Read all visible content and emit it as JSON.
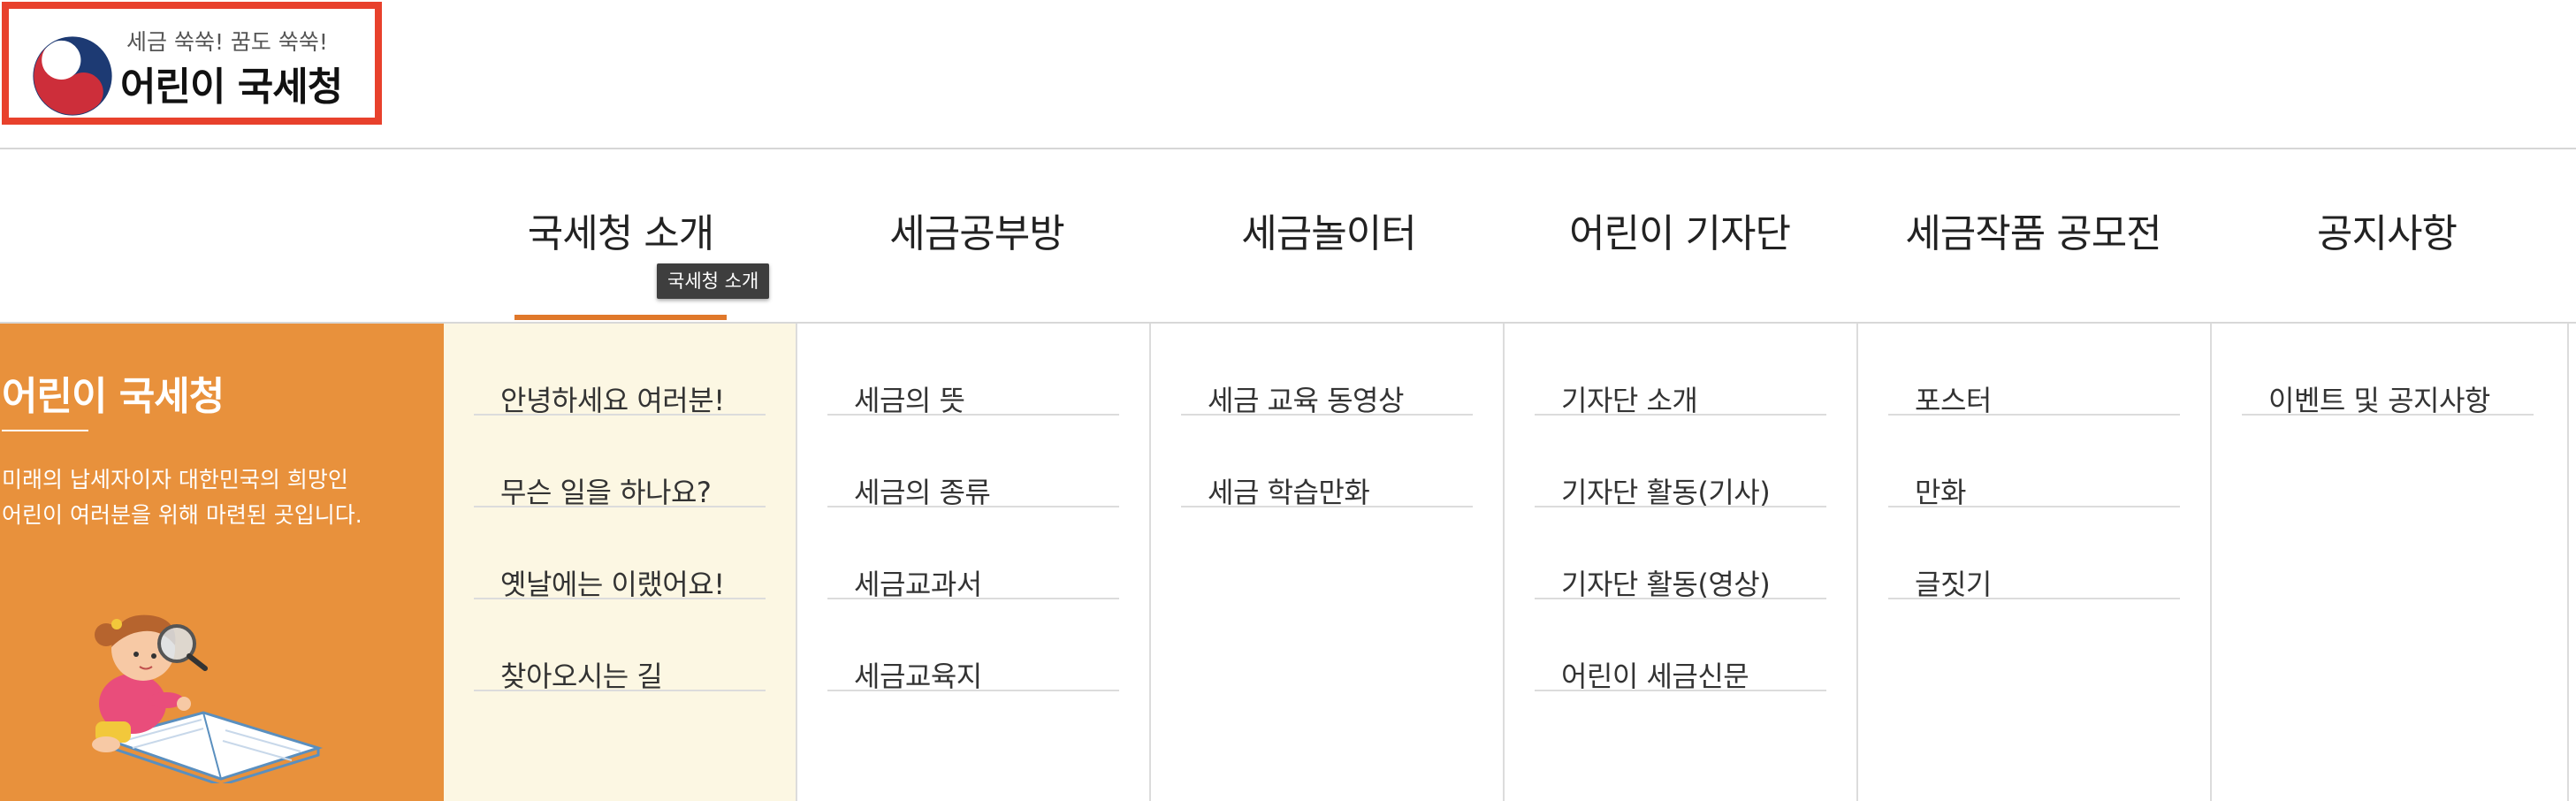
{
  "header": {
    "slogan": "세금 쑥쑥! 꿈도 쑥쑥!",
    "site_name": "어린이 국세청",
    "accent_color": "#e8412c"
  },
  "gnb": {
    "items": [
      {
        "label": "국세청 소개"
      },
      {
        "label": "세금공부방"
      },
      {
        "label": "세금놀이터"
      },
      {
        "label": "어린이 기자단"
      },
      {
        "label": "세금작품 공모전"
      },
      {
        "label": "공지사항"
      }
    ],
    "active_index": 0,
    "tooltip": "국세청 소개",
    "active_color": "#e0782a"
  },
  "intro": {
    "title": "어린이 국세청",
    "desc_line1": "미래의 납세자이자 대한민국의 희망인",
    "desc_line2": "어린이 여러분을 위해 마련된 곳입니다.",
    "panel_color": "#e8913c",
    "illustration": "girl-reading-book-with-magnifier-illustration"
  },
  "submenu": [
    {
      "items": [
        "안녕하세요 여러분!",
        "무슨 일을 하나요?",
        "옛날에는 이랬어요!",
        "찾아오시는 길"
      ]
    },
    {
      "items": [
        "세금의 뜻",
        "세금의 종류",
        "세금교과서",
        "세금교육지"
      ]
    },
    {
      "items": [
        "세금 교육 동영상",
        "세금 학습만화"
      ]
    },
    {
      "items": [
        "기자단 소개",
        "기자단 활동(기사)",
        "기자단 활동(영상)",
        "어린이 세금신문"
      ]
    },
    {
      "items": [
        "포스터",
        "만화",
        "글짓기"
      ]
    },
    {
      "items": [
        "이벤트 및 공지사항"
      ]
    }
  ]
}
